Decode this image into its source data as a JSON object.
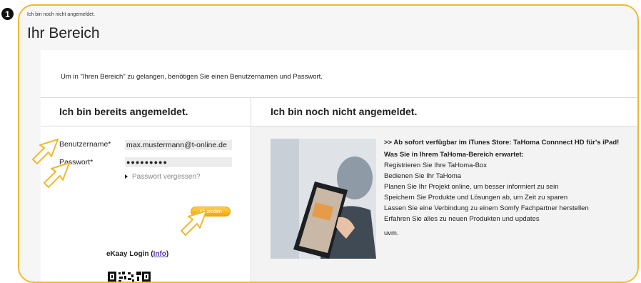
{
  "step_badge": "1",
  "breadcrumb": "Ich bin noch nicht angemeldet.",
  "page_title": "Ihr Bereich",
  "intro_text": "Um in \"Ihren Bereich\" zu gelangen, benötigen Sie einen Benutzernamen und Passwort.",
  "login": {
    "heading": "Ich bin bereits angemeldet.",
    "username_label": "Benutzername*",
    "username_value": "max.mustermann@t-online.de",
    "password_label": "Passwort*",
    "password_value": "●●●●●●●●●",
    "forgot_link": "Passwort vergessen?",
    "submit_label": "Absenden",
    "ekaay_label": "eKaay Login (",
    "ekaay_link": "Info",
    "ekaay_close": ")"
  },
  "register": {
    "heading": "Ich bin noch nicht angemeldet.",
    "promo": ">> Ab sofort verfügbar im iTunes Store: TaHoma Connnect HD für's iPad!",
    "subheading": "Was Sie in Ihrem TaHoma-Bereich erwartet:",
    "items": [
      "Registrieren Sie Ihre TaHoma-Box",
      "Bedienen Sie Ihr TaHoma",
      "Planen Sie Ihr Projekt online, um besser informiert zu sein",
      "Speichern Sie Produkte und Lösungen ab, um Zeit zu sparen",
      "Lassen Sie eine Verbindung zu einem Somfy Fachpartner herstellen",
      "Erfahren Sie alles zu neuen Produkten und updates"
    ],
    "uvm": "uvm."
  },
  "colors": {
    "frame": "#f1b92f",
    "button": "#f0a40e",
    "link": "#5b3bb3"
  }
}
